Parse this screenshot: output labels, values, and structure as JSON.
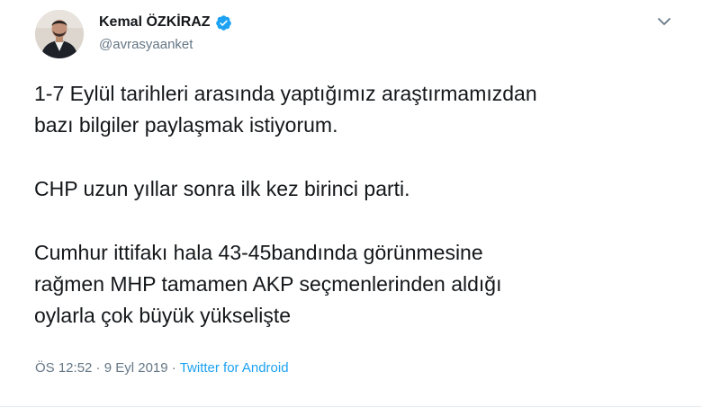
{
  "author": {
    "display_name": "Kemal ÖZKİRAZ",
    "handle": "@avrasyaanket",
    "verified": true,
    "avatar_icon": "user-photo"
  },
  "tweet": {
    "paragraphs": [
      {
        "lines": [
          "1-7 Eylül tarihleri arasında yaptığımız araştırmamızdan",
          "bazı bilgiler paylaşmak istiyorum."
        ]
      },
      {
        "lines": [
          "CHP uzun yıllar sonra ilk kez birinci parti."
        ]
      },
      {
        "lines": [
          "Cumhur ittifakı hala 43-45bandında görünmesine",
          "rağmen MHP tamamen AKP seçmenlerinden aldığı",
          "oylarla çok büyük yükselişte"
        ]
      }
    ]
  },
  "meta": {
    "time": "ÖS 12:52",
    "separator1": " · ",
    "date": "9 Eyl 2019",
    "separator2": " · ",
    "source": "Twitter for Android"
  },
  "colors": {
    "text": "#14171a",
    "secondary": "#657786",
    "accent": "#1da1f2"
  }
}
